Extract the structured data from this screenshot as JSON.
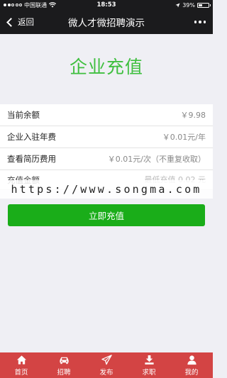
{
  "status": {
    "carrier": "中国联通",
    "time": "18:53",
    "battery": "39%",
    "battery_level": 0.39
  },
  "nav": {
    "back_label": "返回",
    "title": "微人才微招聘演示"
  },
  "page": {
    "title": "企业充值"
  },
  "rows": [
    {
      "label": "当前余额",
      "value": "￥9.98"
    },
    {
      "label": "企业入驻年费",
      "value": "￥0.01元/年"
    },
    {
      "label": "查看简历费用",
      "value": "￥0.01元/次（不重复收取）"
    }
  ],
  "recharge": {
    "label": "充值金额",
    "placeholder": "最低充值 0.02 元"
  },
  "watermark": "https://www.songma.com",
  "button": {
    "label": "立即充值"
  },
  "tabs": [
    {
      "icon": "home-icon",
      "label": "首页"
    },
    {
      "icon": "car-icon",
      "label": "招聘"
    },
    {
      "icon": "send-icon",
      "label": "发布"
    },
    {
      "icon": "download-icon",
      "label": "求职"
    },
    {
      "icon": "user-icon",
      "label": "我的"
    }
  ],
  "colors": {
    "nav_bg": "#1b1b1d",
    "title_green": "#3fbf3f",
    "button_green": "#1aad19",
    "tabbar_red": "#d34444"
  }
}
